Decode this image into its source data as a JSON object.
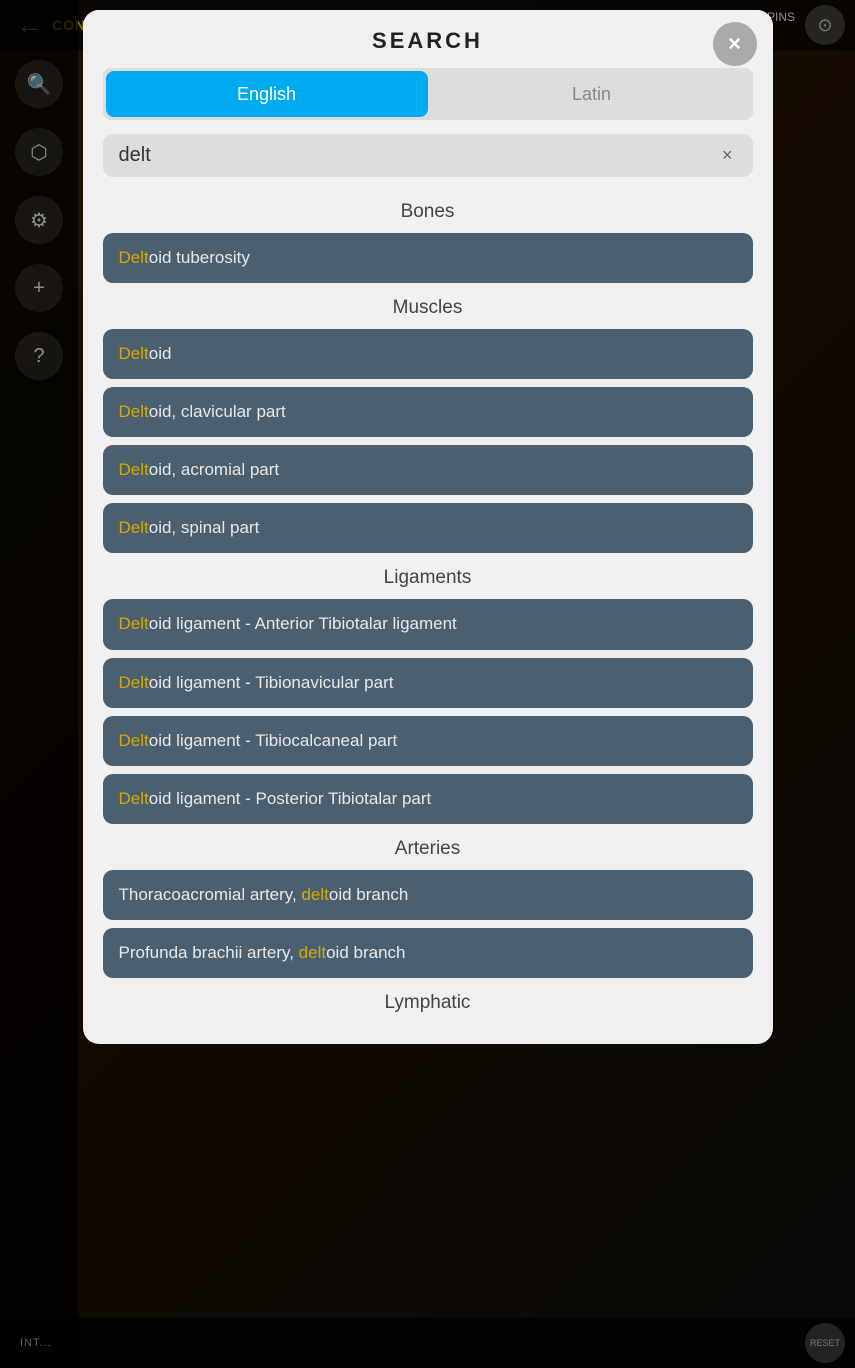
{
  "app": {
    "back_text": "CONT",
    "pins_label": "PINS",
    "reset_label": "RESET",
    "bottom_bar_text": "INT..."
  },
  "modal": {
    "title": "SEARCH",
    "close_label": "×",
    "lang_tabs": [
      {
        "id": "english",
        "label": "English",
        "active": true
      },
      {
        "id": "latin",
        "label": "Latin",
        "active": false
      }
    ],
    "search": {
      "value": "delt",
      "clear_label": "×"
    },
    "sections": [
      {
        "id": "bones",
        "header": "Bones",
        "items": [
          {
            "id": "deltoid-tuberosity",
            "highlight": "Delt",
            "rest": "oid tuberosity"
          }
        ]
      },
      {
        "id": "muscles",
        "header": "Muscles",
        "items": [
          {
            "id": "deltoid",
            "highlight": "Delt",
            "rest": "oid"
          },
          {
            "id": "deltoid-clavicular",
            "highlight": "Delt",
            "rest": "oid, clavicular part"
          },
          {
            "id": "deltoid-acromial",
            "highlight": "Delt",
            "rest": "oid, acromial part"
          },
          {
            "id": "deltoid-spinal",
            "highlight": "Delt",
            "rest": "oid, spinal part"
          }
        ]
      },
      {
        "id": "ligaments",
        "header": "Ligaments",
        "items": [
          {
            "id": "deltoid-lig-ant",
            "highlight": "Delt",
            "rest": "oid ligament - Anterior Tibiotalar ligament"
          },
          {
            "id": "deltoid-lig-tib",
            "highlight": "Delt",
            "rest": "oid ligament - Tibionavicular part"
          },
          {
            "id": "deltoid-lig-calc",
            "highlight": "Delt",
            "rest": "oid ligament - Tibiocalcaneal part"
          },
          {
            "id": "deltoid-lig-post",
            "highlight": "Delt",
            "rest": "oid ligament - Posterior Tibiotalar part"
          }
        ]
      },
      {
        "id": "arteries",
        "header": "Arteries",
        "items": [
          {
            "id": "thoracoacromial",
            "pre": "Thoracoacromial artery, ",
            "highlight": "delt",
            "post": "oid branch"
          },
          {
            "id": "profunda-brachii",
            "pre": "Profunda brachii artery, ",
            "highlight": "delt",
            "post": "oid branch"
          }
        ]
      },
      {
        "id": "lymphatic",
        "header": "Lymphatic",
        "items": []
      }
    ]
  },
  "sidebar": {
    "icons": [
      {
        "id": "search",
        "symbol": "🔍"
      },
      {
        "id": "filter",
        "symbol": "⬡"
      },
      {
        "id": "settings",
        "symbol": "⚙"
      },
      {
        "id": "add",
        "symbol": "+"
      },
      {
        "id": "help",
        "symbol": "?"
      }
    ]
  }
}
